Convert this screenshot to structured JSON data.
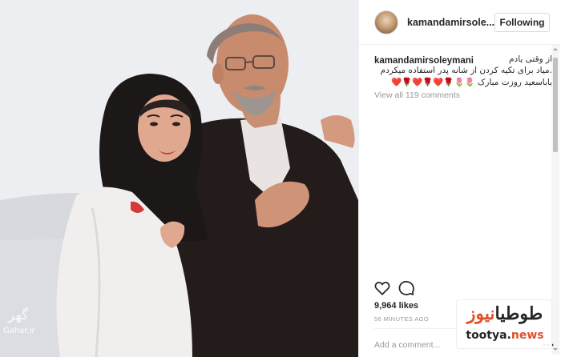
{
  "post": {
    "username": "kamandamirsole...",
    "follow_label": "Following",
    "caption": {
      "username": "kamandamirsoleymani",
      "lines": [
        "از وقتی یادم",
        ".میاد برای تکیه کردن از شانه پدر استفاده میکردم",
        "باباسعید روزت مبارک 🌷🌷🌹❤️🌹❤️🌹❤️"
      ]
    },
    "view_all_comments": "View all 119 comments",
    "likes": "9,964 likes",
    "time_ago": "56 MINUTES AGO",
    "add_comment_placeholder": "Add a comment...",
    "more_icon": "more-dots-icon"
  },
  "icons": {
    "like": "heart-icon",
    "comment": "speech-bubble-icon"
  },
  "watermarks": {
    "left_glyph": "گهر",
    "left_site": "Gahar.ir",
    "right_fa_black": "طوطیا",
    "right_fa_accent": "نیوز",
    "right_en_black": "tootya.",
    "right_en_accent": "news"
  },
  "colors": {
    "text": "#262626",
    "muted": "#999999",
    "border": "#dbdbdb",
    "accent": "#e0502a"
  }
}
